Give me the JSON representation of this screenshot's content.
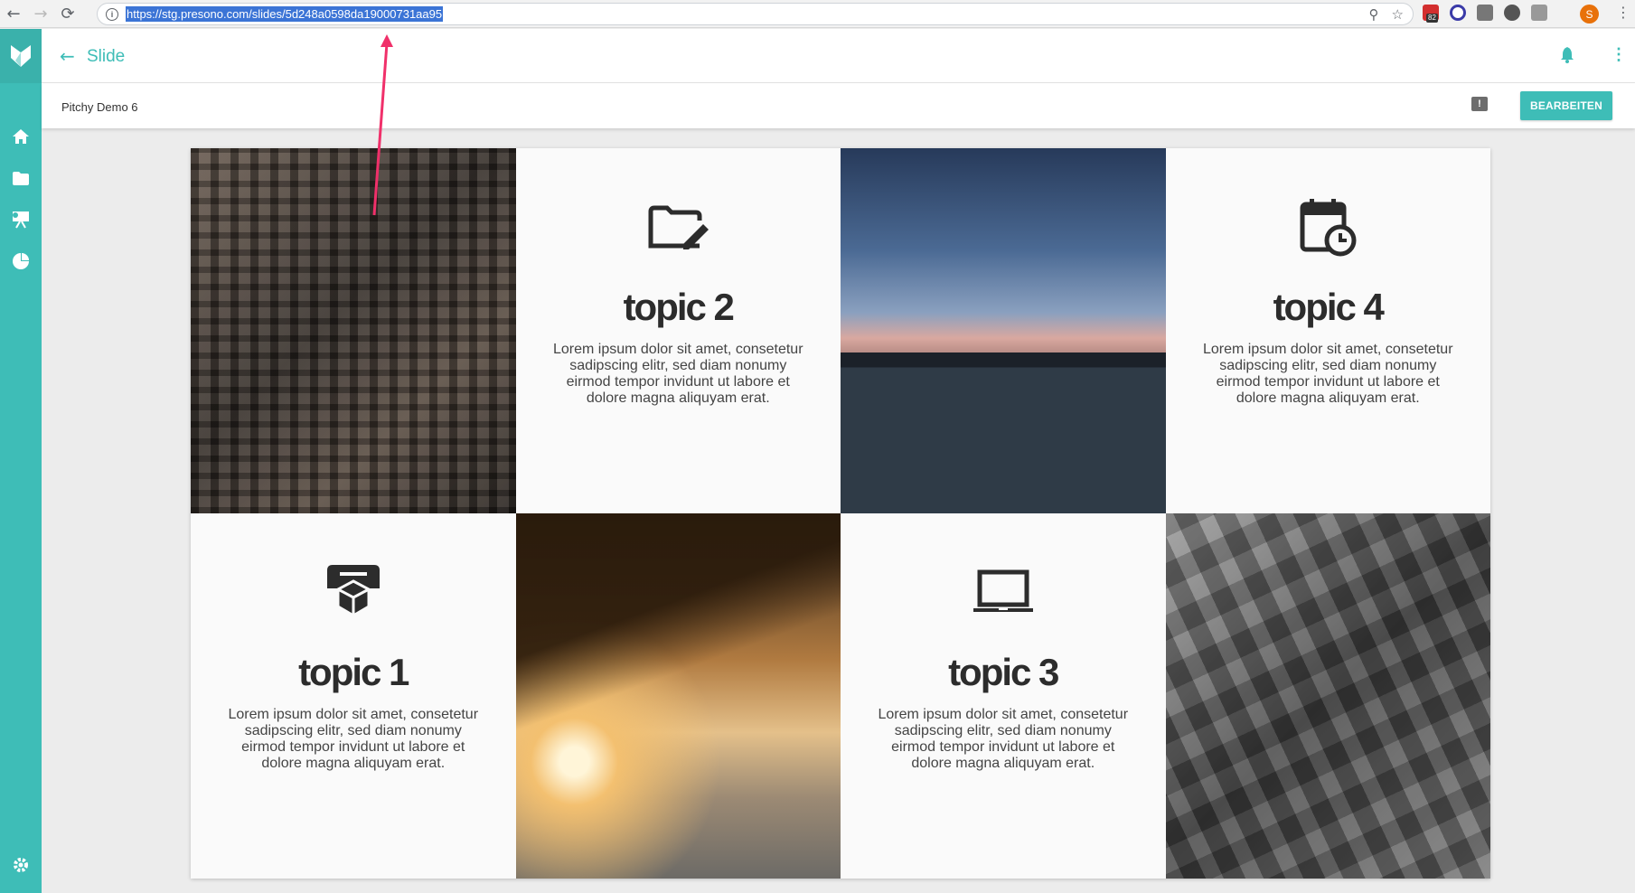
{
  "browser": {
    "url": "https://stg.presono.com/slides/5d248a0598da19000731aa95",
    "back_icon": "←",
    "forward_icon": "→",
    "reload_icon": "⟳",
    "zoom_icon": "⚲",
    "star_icon": "☆",
    "ext_badge": "82",
    "profile_initial": "S",
    "menu_icon": "⋮"
  },
  "app": {
    "accent_color": "#3ebdb7",
    "header": {
      "back_icon": "←",
      "title": "Slide",
      "menu_icon": "⋮"
    },
    "subheader": {
      "deck_name": "Pitchy Demo 6",
      "comment_icon": "!",
      "edit_label": "BEARBEITEN"
    },
    "sidebar": [
      "home-icon",
      "folder-icon",
      "presentation-icon",
      "pie-chart-icon",
      "settings-icon"
    ]
  },
  "slide": {
    "tiles": [
      {
        "kind": "image",
        "name": "city-aerial-image"
      },
      {
        "kind": "text",
        "icon": "folder-edit-icon",
        "title": "topic 2",
        "body": "Lorem ipsum dolor sit amet, consetetur sadipscing elitr, sed diam nonumy eirmod tempor invidunt ut labore et dolore magna aliquyam erat."
      },
      {
        "kind": "image",
        "name": "skyline-sunset-image"
      },
      {
        "kind": "text",
        "icon": "calendar-clock-icon",
        "title": "topic 4",
        "body": "Lorem ipsum dolor sit amet, consetetur sadipscing elitr, sed diam nonumy eirmod tempor invidunt ut labore et dolore magna aliquyam erat."
      },
      {
        "kind": "text",
        "icon": "box-printer-icon",
        "title": "topic 1",
        "body": "Lorem ipsum dolor sit amet, consetetur sadipscing elitr, sed diam nonumy eirmod tempor invidunt ut labore et dolore magna aliquyam erat."
      },
      {
        "kind": "image",
        "name": "pier-sunset-image"
      },
      {
        "kind": "text",
        "icon": "laptop-icon",
        "title": "topic 3",
        "body": "Lorem ipsum dolor sit amet, consetetur sadipscing elitr, sed diam nonumy eirmod tempor invidunt ut labore et dolore magna aliquyam erat."
      },
      {
        "kind": "image",
        "name": "grayscale-aerial-image"
      }
    ]
  }
}
